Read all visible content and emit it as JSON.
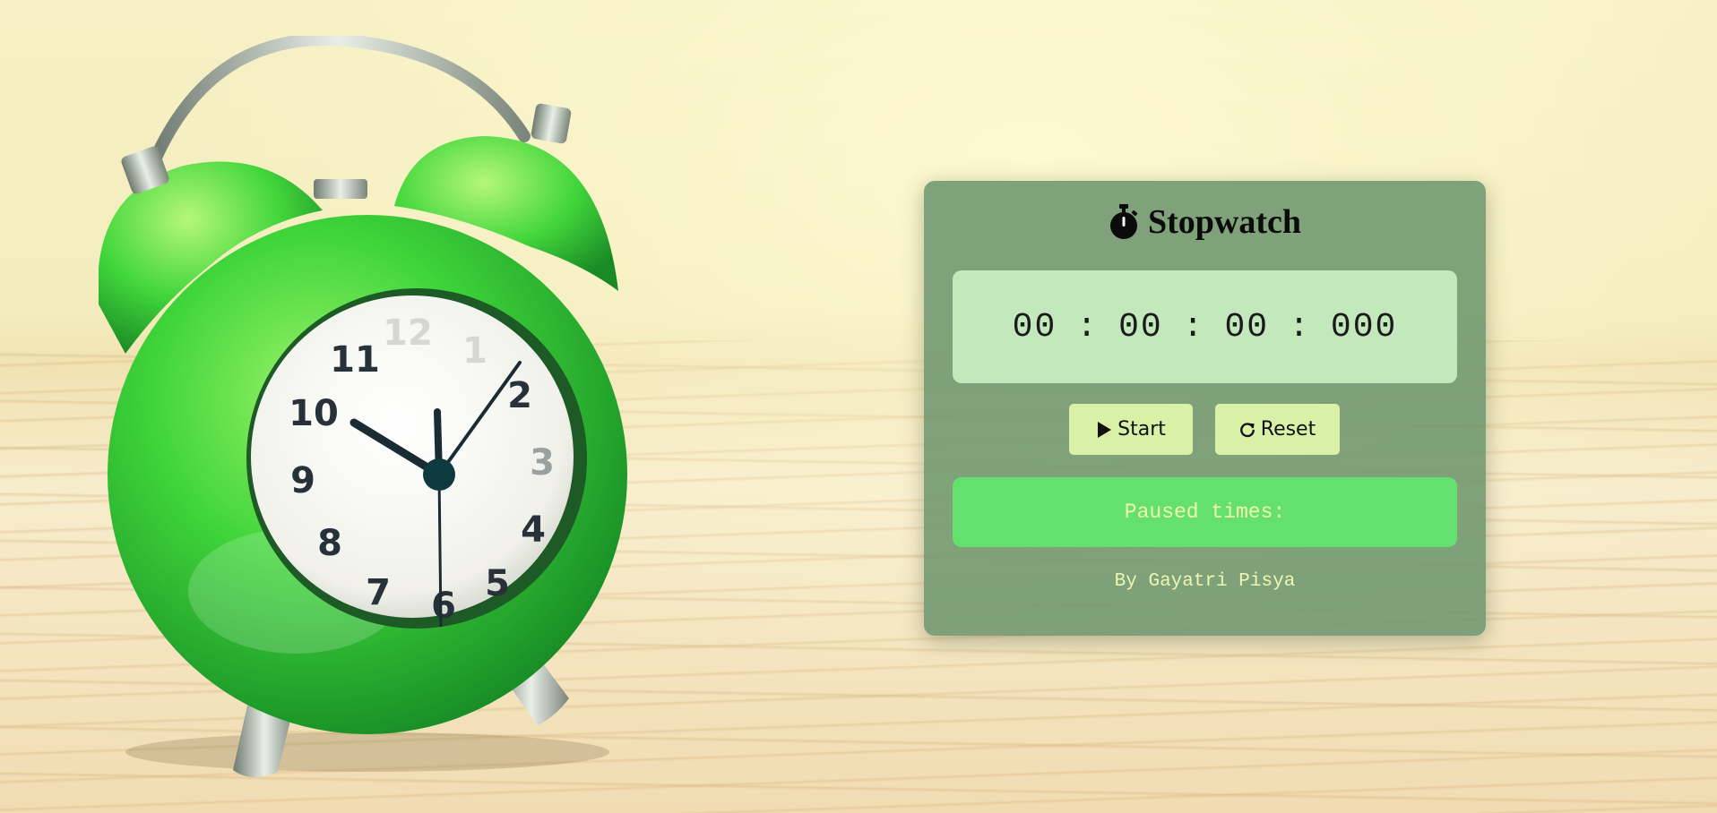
{
  "app": {
    "title": "Stopwatch",
    "title_icon": "stopwatch-icon"
  },
  "display": {
    "hours": "00",
    "minutes": "00",
    "seconds": "00",
    "milliseconds": "000",
    "separator": ":"
  },
  "controls": {
    "start_label": "Start",
    "start_icon": "play-icon",
    "reset_label": "Reset",
    "reset_icon": "reload-icon"
  },
  "paused": {
    "label": "Paused times:"
  },
  "footer": {
    "byline": "By Gayatri Pisya"
  },
  "colors": {
    "card": "#6e966e",
    "display_bg": "#c3e8bc",
    "button_bg": "#d8f1a6",
    "paused_bg": "#64e06f",
    "accent_text": "#eef6b0"
  }
}
